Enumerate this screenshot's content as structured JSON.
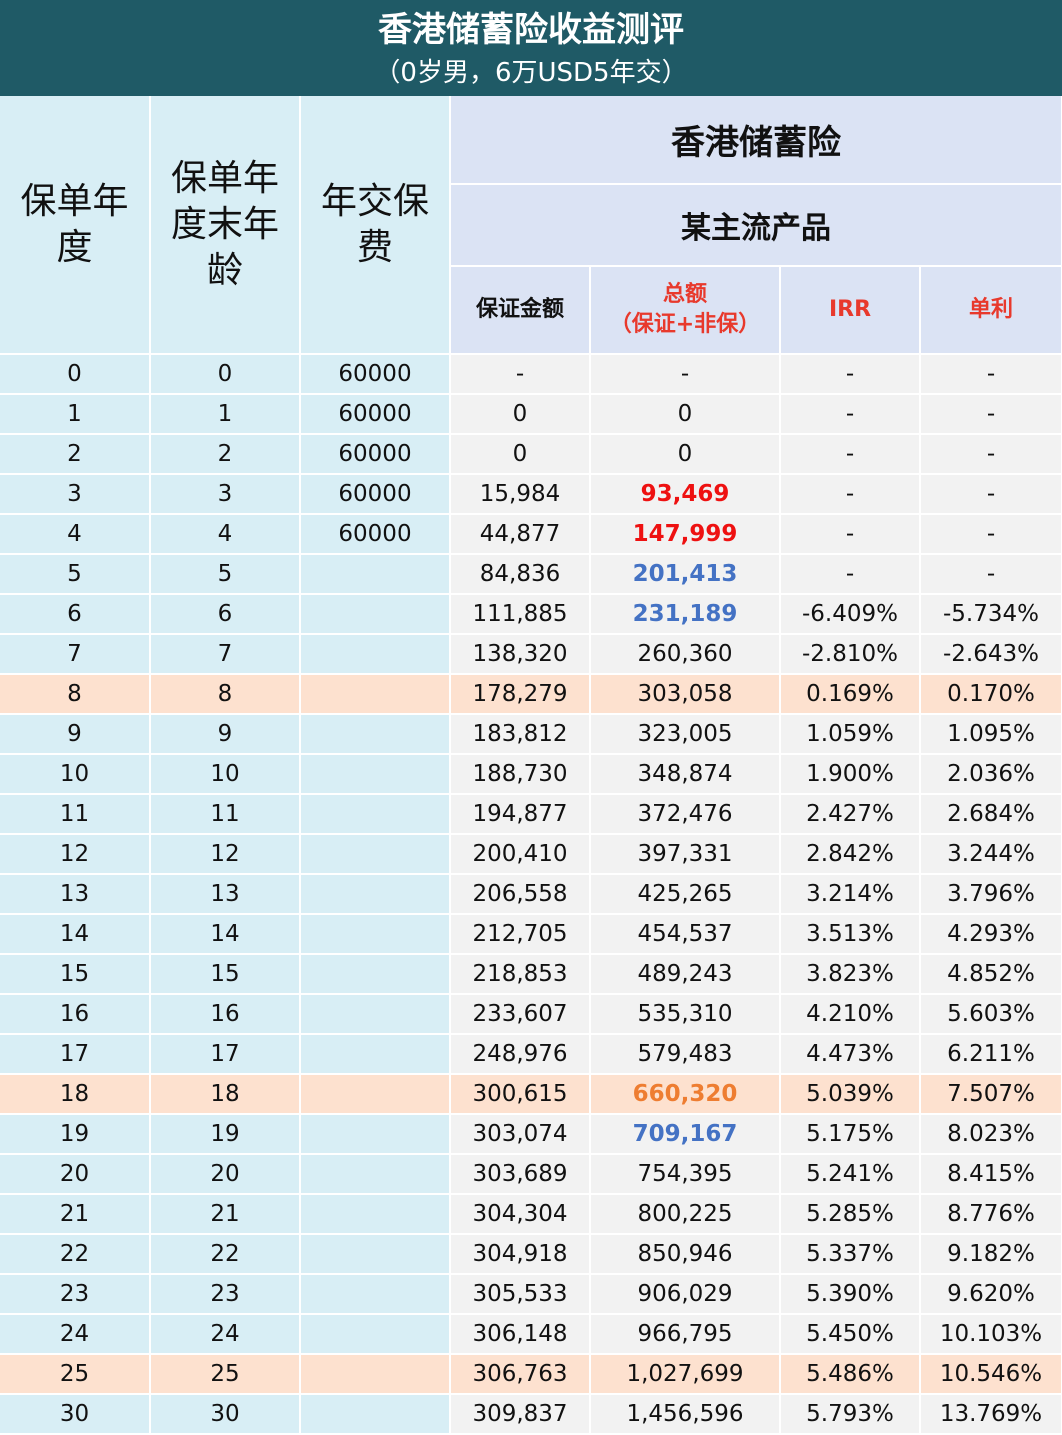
{
  "title": "香港储蓄险收益测评",
  "subtitle": "（0岁男，6万USD5年交）",
  "header": {
    "col_year": "保单年度",
    "col_age": "保单年度末年龄",
    "col_premium": "年交保费",
    "product_group": "香港储蓄险",
    "product_name": "某主流产品",
    "col_guaranteed": "保证金额",
    "col_total_line1": "总额",
    "col_total_line2": "（保证+非保）",
    "col_irr": "IRR",
    "col_simple": "单利"
  },
  "colors": {
    "title_bg": "#1f5a66",
    "left_cell_bg": "#d8eef5",
    "header_bg": "#dbe3f4",
    "right_cell_bg": "#f2f2f2",
    "highlight_bg": "#fde1cf",
    "red": "#ee1111",
    "blue": "#4472c4",
    "orange": "#ee7d31"
  },
  "rows": [
    {
      "year": "0",
      "age": "0",
      "premium": "60000",
      "guaranteed": "-",
      "total": "-",
      "irr": "-",
      "simple": "-",
      "hl": false,
      "total_color": ""
    },
    {
      "year": "1",
      "age": "1",
      "premium": "60000",
      "guaranteed": "0",
      "total": "0",
      "irr": "-",
      "simple": "-",
      "hl": false,
      "total_color": ""
    },
    {
      "year": "2",
      "age": "2",
      "premium": "60000",
      "guaranteed": "0",
      "total": "0",
      "irr": "-",
      "simple": "-",
      "hl": false,
      "total_color": ""
    },
    {
      "year": "3",
      "age": "3",
      "premium": "60000",
      "guaranteed": "15,984",
      "total": "93,469",
      "irr": "-",
      "simple": "-",
      "hl": false,
      "total_color": "red"
    },
    {
      "year": "4",
      "age": "4",
      "premium": "60000",
      "guaranteed": "44,877",
      "total": "147,999",
      "irr": "-",
      "simple": "-",
      "hl": false,
      "total_color": "red"
    },
    {
      "year": "5",
      "age": "5",
      "premium": "",
      "guaranteed": "84,836",
      "total": "201,413",
      "irr": "-",
      "simple": "-",
      "hl": false,
      "total_color": "blue"
    },
    {
      "year": "6",
      "age": "6",
      "premium": "",
      "guaranteed": "111,885",
      "total": "231,189",
      "irr": "-6.409%",
      "simple": "-5.734%",
      "hl": false,
      "total_color": "blue"
    },
    {
      "year": "7",
      "age": "7",
      "premium": "",
      "guaranteed": "138,320",
      "total": "260,360",
      "irr": "-2.810%",
      "simple": "-2.643%",
      "hl": false,
      "total_color": ""
    },
    {
      "year": "8",
      "age": "8",
      "premium": "",
      "guaranteed": "178,279",
      "total": "303,058",
      "irr": "0.169%",
      "simple": "0.170%",
      "hl": true,
      "total_color": ""
    },
    {
      "year": "9",
      "age": "9",
      "premium": "",
      "guaranteed": "183,812",
      "total": "323,005",
      "irr": "1.059%",
      "simple": "1.095%",
      "hl": false,
      "total_color": ""
    },
    {
      "year": "10",
      "age": "10",
      "premium": "",
      "guaranteed": "188,730",
      "total": "348,874",
      "irr": "1.900%",
      "simple": "2.036%",
      "hl": false,
      "total_color": ""
    },
    {
      "year": "11",
      "age": "11",
      "premium": "",
      "guaranteed": "194,877",
      "total": "372,476",
      "irr": "2.427%",
      "simple": "2.684%",
      "hl": false,
      "total_color": ""
    },
    {
      "year": "12",
      "age": "12",
      "premium": "",
      "guaranteed": "200,410",
      "total": "397,331",
      "irr": "2.842%",
      "simple": "3.244%",
      "hl": false,
      "total_color": ""
    },
    {
      "year": "13",
      "age": "13",
      "premium": "",
      "guaranteed": "206,558",
      "total": "425,265",
      "irr": "3.214%",
      "simple": "3.796%",
      "hl": false,
      "total_color": ""
    },
    {
      "year": "14",
      "age": "14",
      "premium": "",
      "guaranteed": "212,705",
      "total": "454,537",
      "irr": "3.513%",
      "simple": "4.293%",
      "hl": false,
      "total_color": ""
    },
    {
      "year": "15",
      "age": "15",
      "premium": "",
      "guaranteed": "218,853",
      "total": "489,243",
      "irr": "3.823%",
      "simple": "4.852%",
      "hl": false,
      "total_color": ""
    },
    {
      "year": "16",
      "age": "16",
      "premium": "",
      "guaranteed": "233,607",
      "total": "535,310",
      "irr": "4.210%",
      "simple": "5.603%",
      "hl": false,
      "total_color": ""
    },
    {
      "year": "17",
      "age": "17",
      "premium": "",
      "guaranteed": "248,976",
      "total": "579,483",
      "irr": "4.473%",
      "simple": "6.211%",
      "hl": false,
      "total_color": ""
    },
    {
      "year": "18",
      "age": "18",
      "premium": "",
      "guaranteed": "300,615",
      "total": "660,320",
      "irr": "5.039%",
      "simple": "7.507%",
      "hl": true,
      "total_color": "orange"
    },
    {
      "year": "19",
      "age": "19",
      "premium": "",
      "guaranteed": "303,074",
      "total": "709,167",
      "irr": "5.175%",
      "simple": "8.023%",
      "hl": false,
      "total_color": "blue"
    },
    {
      "year": "20",
      "age": "20",
      "premium": "",
      "guaranteed": "303,689",
      "total": "754,395",
      "irr": "5.241%",
      "simple": "8.415%",
      "hl": false,
      "total_color": ""
    },
    {
      "year": "21",
      "age": "21",
      "premium": "",
      "guaranteed": "304,304",
      "total": "800,225",
      "irr": "5.285%",
      "simple": "8.776%",
      "hl": false,
      "total_color": ""
    },
    {
      "year": "22",
      "age": "22",
      "premium": "",
      "guaranteed": "304,918",
      "total": "850,946",
      "irr": "5.337%",
      "simple": "9.182%",
      "hl": false,
      "total_color": ""
    },
    {
      "year": "23",
      "age": "23",
      "premium": "",
      "guaranteed": "305,533",
      "total": "906,029",
      "irr": "5.390%",
      "simple": "9.620%",
      "hl": false,
      "total_color": ""
    },
    {
      "year": "24",
      "age": "24",
      "premium": "",
      "guaranteed": "306,148",
      "total": "966,795",
      "irr": "5.450%",
      "simple": "10.103%",
      "hl": false,
      "total_color": ""
    },
    {
      "year": "25",
      "age": "25",
      "premium": "",
      "guaranteed": "306,763",
      "total": "1,027,699",
      "irr": "5.486%",
      "simple": "10.546%",
      "hl": true,
      "total_color": ""
    },
    {
      "year": "30",
      "age": "30",
      "premium": "",
      "guaranteed": "309,837",
      "total": "1,456,596",
      "irr": "5.793%",
      "simple": "13.769%",
      "hl": false,
      "total_color": ""
    }
  ]
}
